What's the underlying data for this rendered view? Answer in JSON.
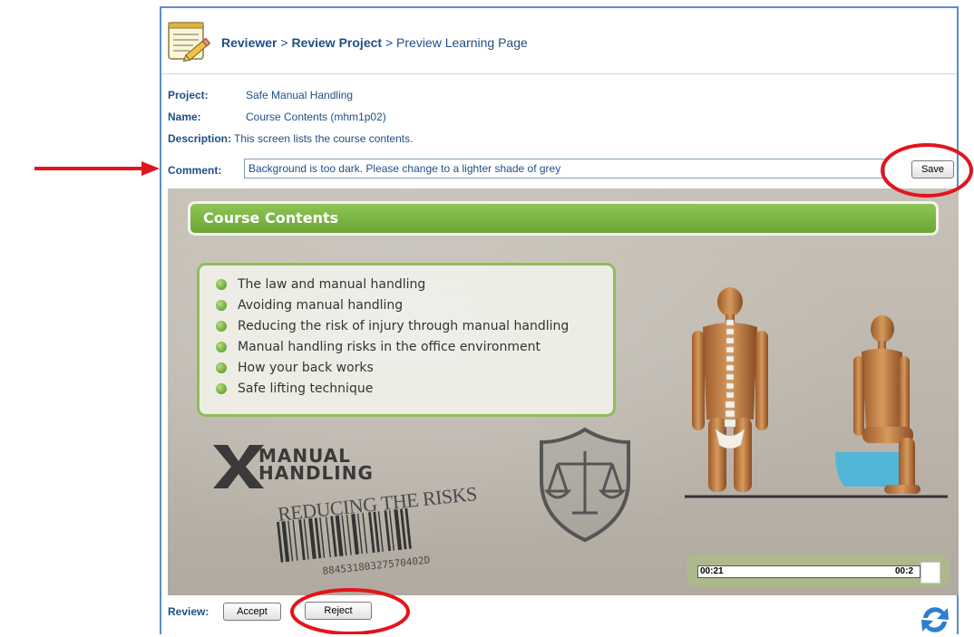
{
  "breadcrumb": {
    "items": [
      "Reviewer",
      "Review Project",
      "Preview Learning Page"
    ],
    "separator": ">"
  },
  "info": {
    "project_label": "Project:",
    "project_value": "Safe Manual Handling",
    "name_label": "Name:",
    "name_value": "Course Contents (mhm1p02)",
    "description_label": "Description:",
    "description_value": "This screen lists the course contents."
  },
  "comment": {
    "label": "Comment:",
    "value": "Background is too dark. Please change to a lighter shade of grey",
    "save_label": "Save"
  },
  "preview": {
    "title": "Course Contents",
    "topics": [
      "The law and manual handling",
      "Avoiding manual handling",
      "Reducing the risk of injury through manual handling",
      "Manual handling risks in the office environment",
      "How your back works",
      "Safe lifting technique"
    ],
    "logo_line1": "MANUAL",
    "logo_line2": "HANDLING",
    "tagline": "REDUCING THE RISKS",
    "barcode_number": "88453180327570402D",
    "time_current": "00:21",
    "time_total": "00:2"
  },
  "review": {
    "label": "Review:",
    "accept_label": "Accept",
    "reject_label": "Reject"
  },
  "colors": {
    "label_blue": "#1f4f86",
    "panel_border": "#5b8ec7",
    "accent_green": "#7ab540",
    "annotation_red": "#e4141b"
  },
  "icons": [
    "notepad-pencil-icon",
    "refresh-icon",
    "bullet-dot-icon"
  ]
}
